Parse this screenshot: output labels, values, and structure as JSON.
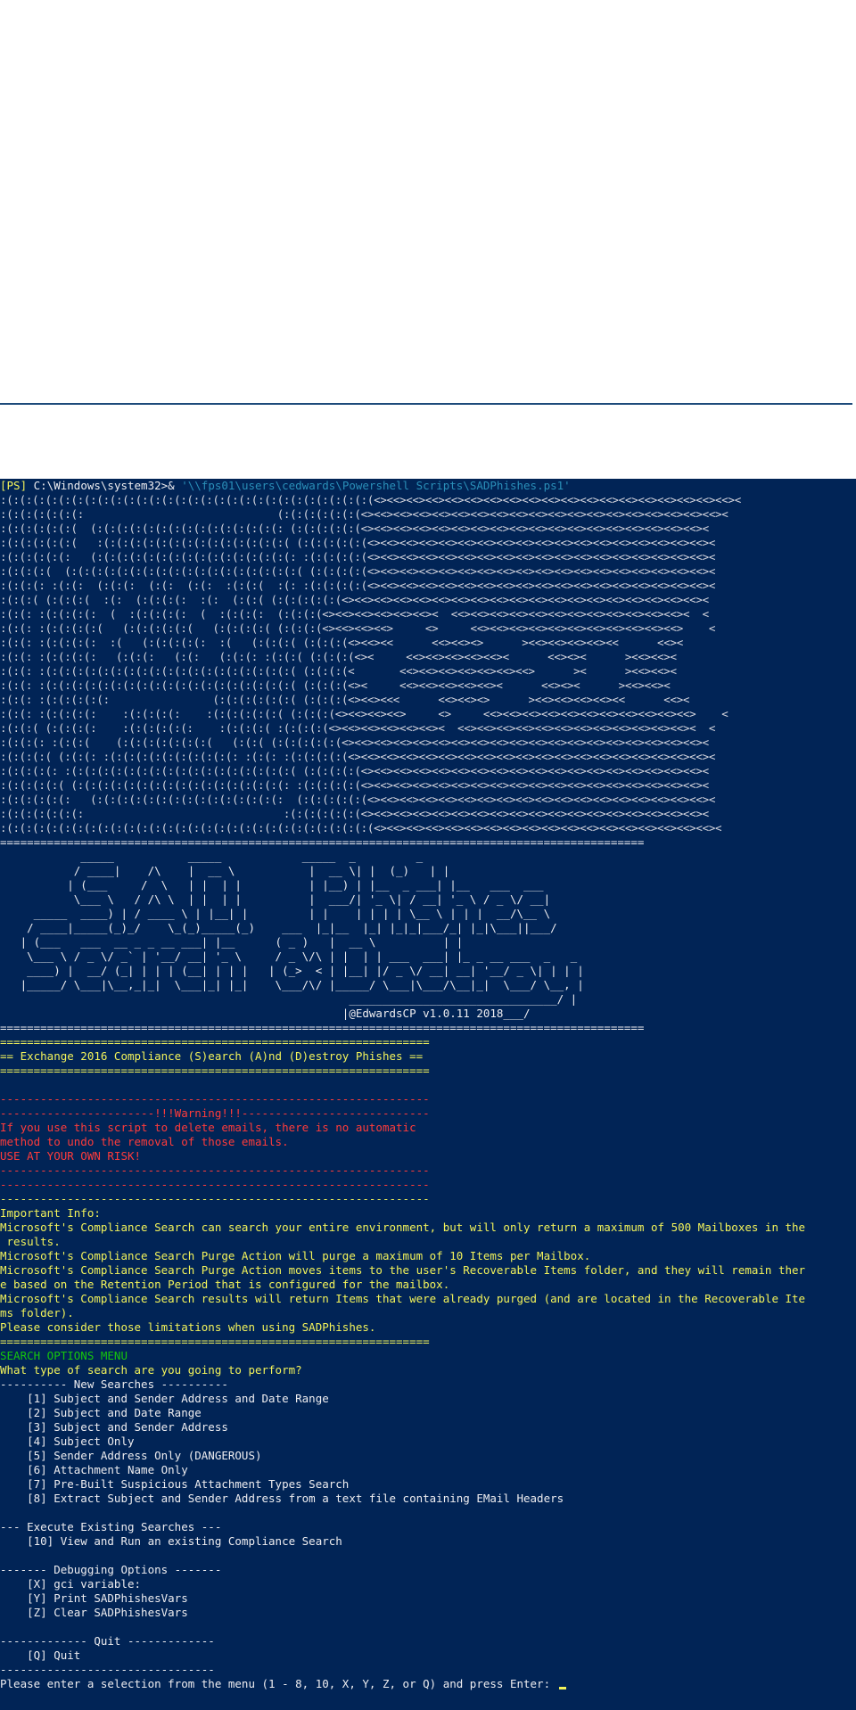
{
  "prompt": {
    "ps_tag": "[PS]",
    "cwd": " C:\\Windows\\system32>&",
    "command": " '\\\\fps01\\users\\cedwards\\Powershell Scripts\\SADPhishes.ps1'"
  },
  "banner_lines": [
    ":(:(:(:(:(:(:(:(:(:(:(:(:(:(:(:(:(:(:(:(:(:(:(:(:(:(:(:(:(<><<><<><<><<><<><<><<><<><<><<><<><<><<><<><<><<><<><<><",
    ":(:(:(:(:(:(:                              (:(:(:(:(:(:(<><<><<><<><<><<><<><<><<><<><<><<><<><<><<><<><<><<><<><",
    ":(:(:(:(:(:(  (:(:(:(:(:(:(:(:(:(:(:(:(:(:(: (:(:(:(:(:(<><<><<><<><<><<><<><<><<><<><<><<><<><<><<><<><<><<><",
    ":(:(:(:(:(:(   :(:(:(:(:(:(:(:(:(:(:(:(:(:(:( (:(:(:(:(:(<><<><<><<><<><<><<><<><<><<><<><<><<><<><<><<><<><<><",
    ":(:(:(:(:(:   (:(:(:(:(:(:(:(:(:(:(:(:(:(:(:(: :(:(:(:(:(<><<><<><<><<><<><<><<><<><<><<><<><<><<><<><<><<><<><",
    ":(:(:(:(  (:(:(:(:(:(:(:(:(:(:(:(:(:(:(:(:(:(:( (:(:(:(:(<><<><<><<><<><<><<><<><<><<><<><<><<><<><<><<><<><<><",
    ":(:(:(: :(:(:  (:(:(:  (:(:  (:(:  :(:(:(  :(: :(:(:(:(:(<><<><<><<><<><<><<><<><<><<><<><<><<><<><<><<><<><<><",
    ":(:(:( (:(:(:(  :(:  (:(:(:(:  :(:  (:(:( (:(:(:(:(:(<><<><<><<><<><<><<><<><<><<><<><<><<><<><<><<><<><<><<><",
    ":(:(: :(:(:(:(:  (  :(:(:(:(:  (  :(:(:(:  (:(:(:(<><<><<><<><<><<><  <<><<><<><<><<><<><<><<><<><<><<><<><  <",
    ":(:(: :(:(:(:(:(   (:(:(:(:(:(   (:(:(:(:( (:(:(:(<><<><<><<>     <>     <<><<><<><<><<><<><<><<><<><<><<>    <",
    ":(:(: :(:(:(:(:  :(   (:(:(:(:(:  :(   (:(:(:( (:(:(:(<><<><<      <<><<><>      ><<><<><<><<><<      <<><",
    ":(:(: :(:(:(:(:   (:(:(:   (:(:   (:(:(: :(:(:( (:(:(:(<><     <<><<><<><<><<><      <<><><      ><<><<><",
    ":(:(: :(:(:(:(:(:(:(:(:(:(:(:(:(:(:(:(:(:(:(:( (:(:(:(<       <<><<><<><<><<><<><<>      ><      ><<><<><",
    ":(:(: :(:(:(:(:(:(:(:(:(:(:(:(:(:(:(:(:(:(:(:( (:(:(:(<><     <<><<><<><<><<><      <<><><      ><<><<><",
    ":(:(: :(:(:(:(:(:                (:(:(:(:(:(:( (:(:(:(<><<><<<      <<><<><>      ><<><<><<><<><<      <<><",
    ":(:(: :(:(:(:(:    :(:(:(:(:    :(:(:(:(:(:( (:(:(:(<><<><<><<>     <>     <<><<><<><<><<><<><<><<><<><<><<>    <",
    ":(:(:( (:(:(:(:    :(:(:(:(:(:    :(:(:(:( :(:(:(:(<><<><<><<><<><<><  <<><<><<><<><<><<><<><<><<><<><<><<><  <",
    ":(:(:(: :(:(:(    (:(:(:(:(:(:(:(   (:(:( (:(:(:(:(:(<><<><<><<><<><<><<><<><<><<><<><<><<><<><<><<><<><<><<><",
    ":(:(:(:( (:(:(: :(:(:(:(:(:(:(:(:(:(: :(:(: :(:(:(:(:(<><<><<><<><<><<><<><<><<><<><<><<><<><<><<><<><<><<><<><",
    ":(:(:(:(: :(:(:(:(:(:(:(:(:(:(:(:(:(:(:(:(:(:( (:(:(:(:(<><<><<><<><<><<><<><<><<><<><<><<><<><<><<><<><<><<><",
    ":(:(:(:(:( (:(:(:(:(:(:(:(:(:(:(:(:(:(:(:(:(: :(:(:(:(:(<><<><<><<><<><<><<><<><<><<><<><<><<><<><<><<><<><<><",
    ":(:(:(:(:(:   (:(:(:(:(:(:(:(:(:(:(:(:(:(:(:  (:(:(:(:(:(<><<><<><<><<><<><<><<><<><<><<><<><<><<><<><<><<><<><",
    ":(:(:(:(:(:(:                               :(:(:(:(:(:(<><<><<><<><<><<><<><<><<><<><<><<><<><<><<><<><<><<><",
    ":(:(:(:(:(:(:(:(:(:(:(:(:(:(:(:(:(:(:(:(:(:(:(:(:(:(:(:(:(<><<><<><<><<><<><<><<><<><<><<><<><<><<><<><<><<><<><"
  ],
  "separator_long": "================================================================================================",
  "logo_lines": [
    "            _____           _____            _____  _         _",
    "           / ____|    /\\    |  __ \\           |  __ \\| |  (_)   | |",
    "          | (___     /  \\   | |  | |          | |__) | |__  _ ___| |__   ___  ___",
    "           \\___ \\   / /\\ \\  | |  | |          |  ___/| '_ \\| / __| '_ \\ / _ \\/ __|",
    "     _____  ____) | / ____ \\ | |__| |         | |    | | | | \\__ \\ | | |  __/\\__ \\",
    "    / ____|_____(_)_/    \\_(_)_____(_)    ___  |_|__  |_| |_|_|___/_| |_|\\___||___/",
    "   | (___   ___  __ _ _ __ ___| |__      ( _ )   |  __ \\          | |",
    "    \\___ \\ / _ \\/ _` | '__/ __| '_ \\     / _ \\/\\ | |  | | ___  ___| |_ _ __ ___  _   _",
    "    ____) |  __/ (_| | | | (__| | | |   | (_>  < | |__| |/ _ \\/ __| __| '__/ _ \\| | | |",
    "   |_____/ \\___|\\__,_|_|  \\___|_| |_|    \\___/\\/ |_____/ \\___|\\___/\\__|_|  \\___/ \\__, |",
    "                                                    _______________________________/ |",
    "                                                   |@EdwardsCP v1.0.11 2018___/"
  ],
  "header": {
    "sep": "================================================================",
    "title": "== Exchange 2016 Compliance (S)earch (A)nd (D)estroy Phishes =="
  },
  "warning": {
    "dash": "----------------------------------------------------------------",
    "title": "-----------------------!!!Warning!!!----------------------------",
    "lines": [
      "If you use this script to delete emails, there is no automatic",
      "method to undo the removal of those emails.",
      "USE AT YOUR OWN RISK!"
    ]
  },
  "info": {
    "heading": "Important Info:",
    "lines": [
      "Microsoft's Compliance Search can search your entire environment, but will only return a maximum of 500 Mailboxes in the",
      " results.",
      "Microsoft's Compliance Search Purge Action will purge a maximum of 10 Items per Mailbox.",
      "Microsoft's Compliance Search Purge Action moves items to the user's Recoverable Items folder, and they will remain ther",
      "e based on the Retention Period that is configured for the mailbox.",
      "Microsoft's Compliance Search results will return Items that were already purged (and are located in the Recoverable Ite",
      "ms folder).",
      "Please consider those limitations when using SADPhishes."
    ],
    "sep": "================================================================"
  },
  "menu": {
    "title": "SEARCH OPTIONS MENU",
    "question": "What type of search are you going to perform?",
    "new_header": "---------- New Searches ----------",
    "new_items": [
      "    [1] Subject and Sender Address and Date Range",
      "    [2] Subject and Date Range",
      "    [3] Subject and Sender Address",
      "    [4] Subject Only",
      "    [5] Sender Address Only (DANGEROUS)",
      "    [6] Attachment Name Only",
      "    [7] Pre-Built Suspicious Attachment Types Search",
      "    [8] Extract Subject and Sender Address from a text file containing EMail Headers"
    ],
    "exec_header": "--- Execute Existing Searches ---",
    "exec_items": [
      "    [10] View and Run an existing Compliance Search"
    ],
    "debug_header": "------- Debugging Options -------",
    "debug_items": [
      "    [X] gci variable:",
      "    [Y] Print SADPhishesVars",
      "    [Z] Clear SADPhishesVars"
    ],
    "quit_header": "------------- Quit -------------",
    "quit_items": [
      "    [Q] Quit"
    ],
    "end_sep": "--------------------------------"
  },
  "input_prompt": "Please enter a selection from the menu (1 - 8, 10, X, Y, Z, or Q) and press Enter: "
}
